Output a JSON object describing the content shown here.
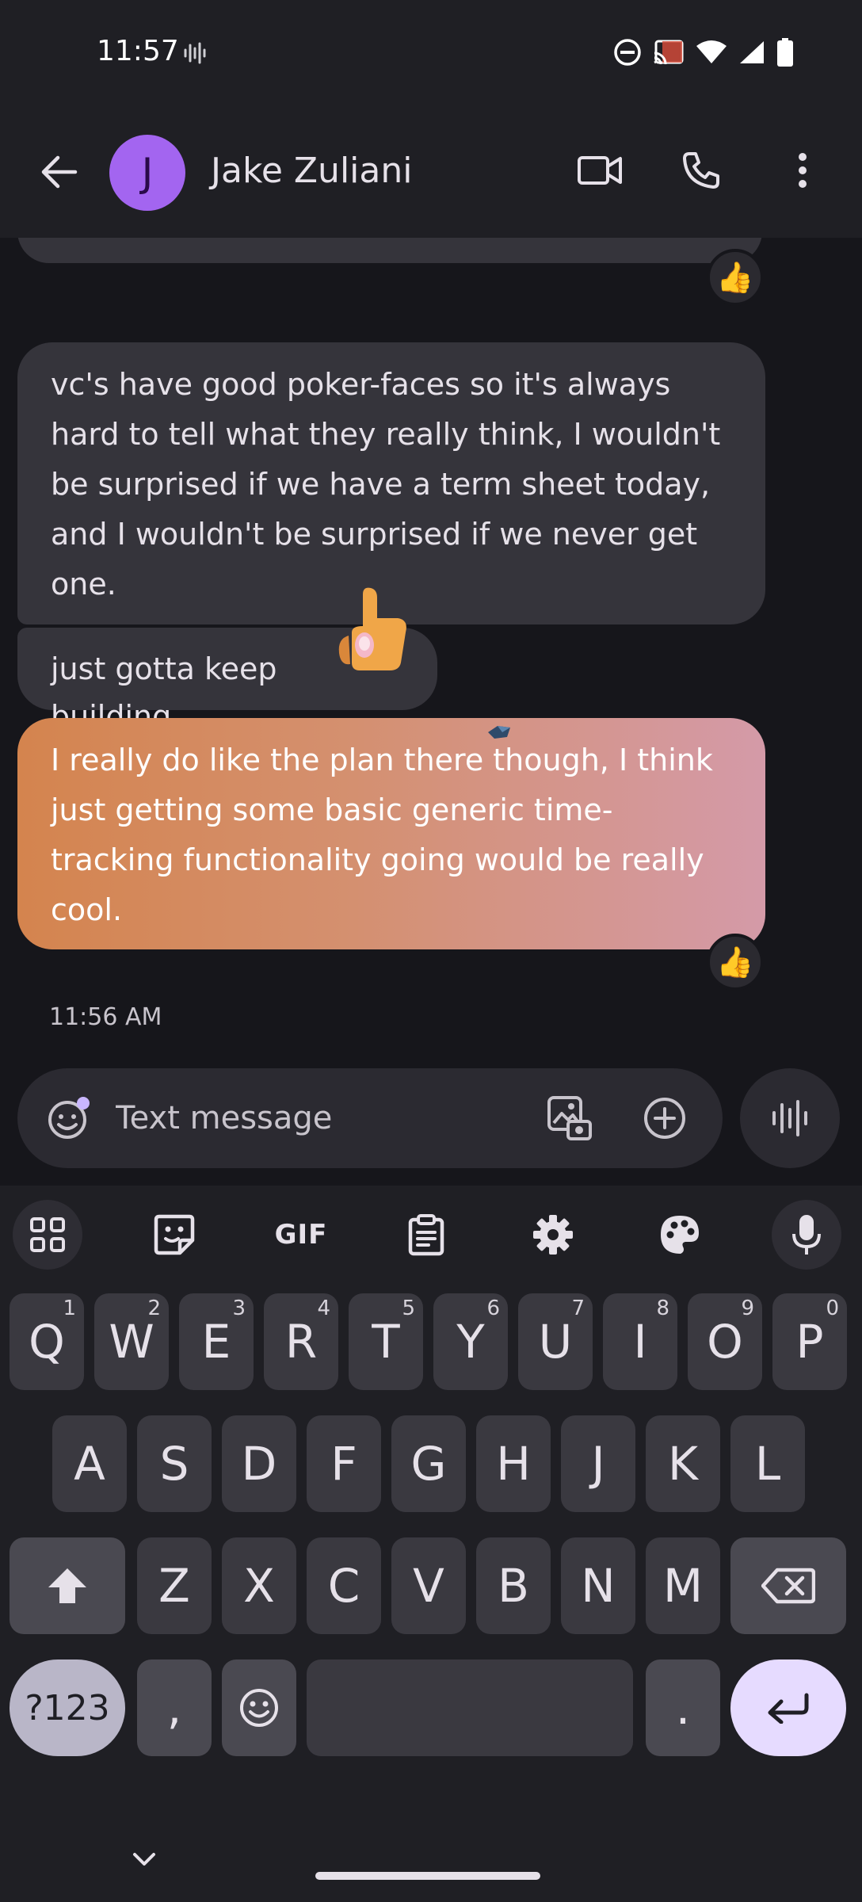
{
  "status_bar": {
    "time": "11:57",
    "icons": [
      "voice-wave-icon",
      "do-not-disturb-icon",
      "cast-icon",
      "wifi-icon",
      "signal-icon",
      "battery-icon"
    ]
  },
  "app_bar": {
    "contact_initial": "J",
    "contact_name": "Jake Zuliani",
    "avatar_color": "#a365f0"
  },
  "messages": [
    {
      "direction": "incoming",
      "text": "vc's have good poker-faces so it's always hard to tell what they really think, I wouldn't be surprised if we have a term sheet today, and I wouldn't be surprised if we never get one."
    },
    {
      "direction": "incoming",
      "text": "just gotta keep building"
    },
    {
      "direction": "outgoing",
      "text": "I really do like the plan there though, I think just getting some basic generic time-tracking functionality going would be really cool."
    }
  ],
  "reactions": [
    "👍",
    "👍"
  ],
  "timestamp": "11:56 AM",
  "compose": {
    "placeholder": "Text message"
  },
  "keyboard": {
    "toolbar_gif": "GIF",
    "row1": [
      {
        "k": "Q",
        "h": "1"
      },
      {
        "k": "W",
        "h": "2"
      },
      {
        "k": "E",
        "h": "3"
      },
      {
        "k": "R",
        "h": "4"
      },
      {
        "k": "T",
        "h": "5"
      },
      {
        "k": "Y",
        "h": "6"
      },
      {
        "k": "U",
        "h": "7"
      },
      {
        "k": "I",
        "h": "8"
      },
      {
        "k": "O",
        "h": "9"
      },
      {
        "k": "P",
        "h": "0"
      }
    ],
    "row2": [
      "A",
      "S",
      "D",
      "F",
      "G",
      "H",
      "J",
      "K",
      "L"
    ],
    "row3": [
      "Z",
      "X",
      "C",
      "V",
      "B",
      "N",
      "M"
    ],
    "symbols_label": "?123",
    "comma": ",",
    "period": "."
  },
  "colors": {
    "background": "#16161b",
    "incoming_bubble": "#35343b",
    "outgoing_gradient_start": "#d4844e",
    "outgoing_gradient_end": "#d49aa8",
    "enter_key": "#e6dbff"
  }
}
